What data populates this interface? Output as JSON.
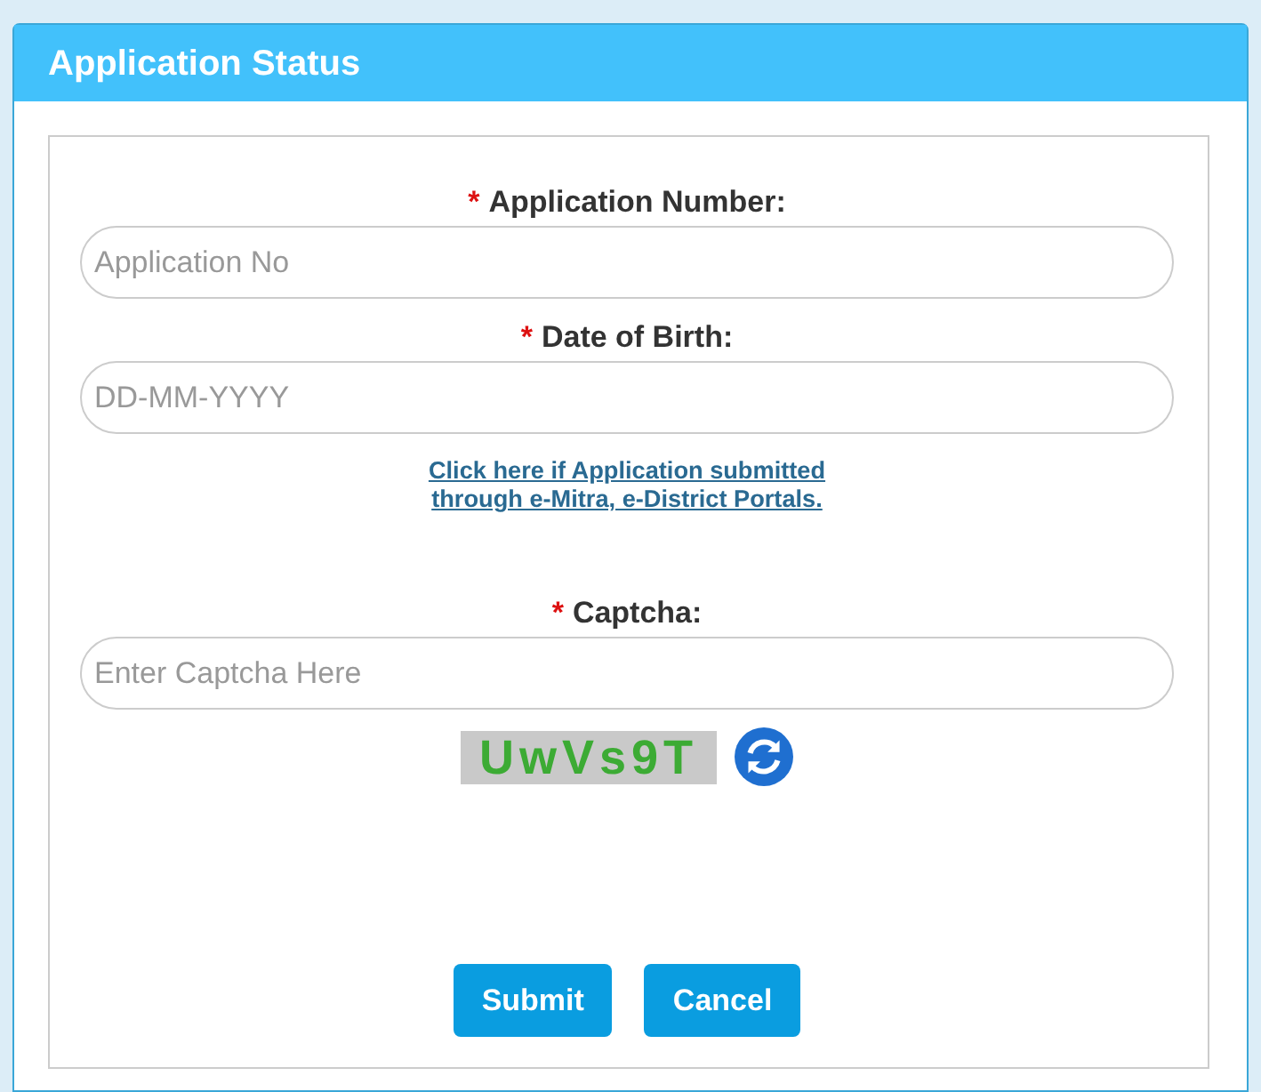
{
  "panel": {
    "title": "Application Status"
  },
  "form": [
    {
      "kind": "field",
      "required_mark": "*",
      "label": "Application Number:",
      "placeholder": "Application No"
    },
    {
      "kind": "field",
      "required_mark": "*",
      "label": "Date of Birth:",
      "placeholder": "DD-MM-YYYY"
    },
    {
      "kind": "link",
      "text": "Click here if Application submitted through e-Mitra, e-District Portals."
    },
    {
      "kind": "field",
      "required_mark": "*",
      "label": "Captcha:",
      "placeholder": "Enter Captcha Here"
    },
    {
      "kind": "captcha",
      "code": "UwVs9T"
    }
  ],
  "buttons": [
    "Submit",
    "Cancel"
  ]
}
